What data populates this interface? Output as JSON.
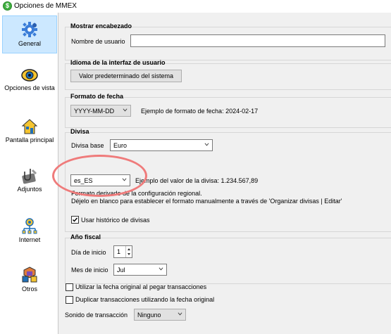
{
  "window": {
    "title": "Opciones de MMEX",
    "app_icon_glyph": "$"
  },
  "sidebar": {
    "items": [
      {
        "label": "General",
        "icon": "gear-icon",
        "selected": true
      },
      {
        "label": "Opciones de vista",
        "icon": "eye-icon"
      },
      {
        "label": "Pantalla principal",
        "icon": "home-icon"
      },
      {
        "label": "Adjuntos",
        "icon": "paperclip-icon"
      },
      {
        "label": "Internet",
        "icon": "network-icon"
      },
      {
        "label": "Otros",
        "icon": "cubes-icon"
      }
    ]
  },
  "header_group": {
    "title": "Mostrar encabezado",
    "username_label": "Nombre de usuario",
    "username_value": ""
  },
  "language_group": {
    "title": "Idioma de la interfaz de usuario",
    "button_label": "Valor predeterminado del sistema"
  },
  "date_group": {
    "title": "Formato de fecha",
    "format_value": "YYYY-MM-DD",
    "example_text": "Ejemplo de formato de fecha:  2024-02-17"
  },
  "currency_group": {
    "title": "Divisa",
    "base_label": "Divisa base",
    "base_value": "Euro",
    "locale_value": "es_ES",
    "example_text": "Ejemplo del valor de la divisa: 1.234.567,89",
    "derived_text": "Formato derivado de la configuración regional.",
    "hint_text": "Déjelo en blanco para establecer el formato manualmente a través de 'Organizar divisas | Editar'",
    "history_label": "Usar histórico de divisas",
    "history_checked": true
  },
  "fiscal_group": {
    "title": "Año fiscal",
    "start_day_label": "Día de inicio",
    "start_day_value": "1",
    "start_month_label": "Mes de inicio",
    "start_month_value": "Jul"
  },
  "misc": {
    "use_original_date_label": "Utilizar la fecha original al pegar transacciones",
    "use_original_date_checked": false,
    "duplicate_label": "Duplicar transacciones utilizando la fecha original",
    "duplicate_checked": false,
    "sound_label": "Sonido de transacción",
    "sound_value": "Ninguno"
  },
  "colors": {
    "selection_bg": "#cce8ff",
    "annotation_circle": "#ef7b7b",
    "window_bg": "#f0f0f0"
  }
}
